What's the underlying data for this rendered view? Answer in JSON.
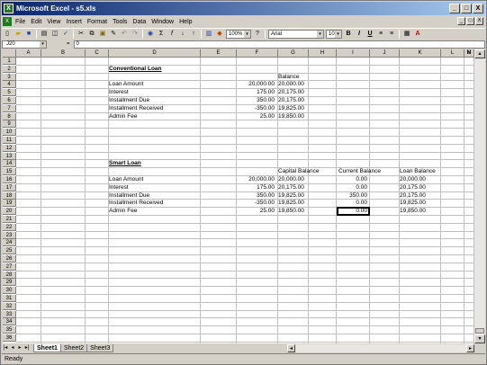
{
  "window": {
    "title": "Microsoft Excel - s5.xls",
    "app_icon": "excel-icon"
  },
  "titlebar_buttons": [
    "_",
    "□",
    "X"
  ],
  "doc_buttons": [
    "_",
    "□",
    "X"
  ],
  "menu": [
    "File",
    "Edit",
    "View",
    "Insert",
    "Format",
    "Tools",
    "Data",
    "Window",
    "Help"
  ],
  "toolbar": {
    "zoom": "100%",
    "font": "Arial",
    "size": "10"
  },
  "formula_bar": {
    "name_box": "J20",
    "fx": "=",
    "value": "0"
  },
  "columns": [
    "A",
    "B",
    "C",
    "D",
    "E",
    "F",
    "G",
    "H",
    "I",
    "J",
    "K",
    "L",
    "M",
    "N"
  ],
  "rows": [
    "1",
    "2",
    "3",
    "4",
    "5",
    "6",
    "7",
    "8",
    "9",
    "10",
    "11",
    "12",
    "13",
    "14",
    "15",
    "16",
    "17",
    "18",
    "19",
    "20",
    "21",
    "22",
    "23",
    "24",
    "25",
    "26",
    "27",
    "28",
    "29",
    "30",
    "31",
    "32",
    "33",
    "34",
    "35",
    "36"
  ],
  "cells": {
    "conv_title": "Conventional Loan",
    "conv_balance_hdr": "Balance",
    "conv_labels": [
      "Loan Amount",
      "Interest",
      "Installment Due",
      "Installment Received",
      "Admin Fee"
    ],
    "conv_values": [
      "20,000.00",
      "175.00",
      "350.00",
      "-350.00",
      "25.00"
    ],
    "conv_balances": [
      "20,000.00",
      "20,175.00",
      "20,175.00",
      "19,825.00",
      "19,850.00"
    ],
    "smart_title": "Smart Loan",
    "smart_hdrs": [
      "Capital Balance",
      "Current Balance",
      "Loan Balance"
    ],
    "smart_labels": [
      "Loan Amount",
      "Interest",
      "Installment Due",
      "Installment Received",
      "Admin Fee"
    ],
    "smart_values": [
      "20,000.00",
      "175.00",
      "350.00",
      "-350.00",
      "25.00"
    ],
    "smart_capital": [
      "20,000.00",
      "20,175.00",
      "19,825.00",
      "19,825.00",
      "19,850.00"
    ],
    "smart_current": [
      "0.00",
      "0.00",
      "350.00",
      "0.00",
      "0.00"
    ],
    "smart_loan": [
      "20,000.00",
      "20,175.00",
      "20,175.00",
      "19,825.00",
      "19,850.00"
    ]
  },
  "sheets": [
    "Sheet1",
    "Sheet2",
    "Sheet3"
  ],
  "active_sheet": "Sheet1",
  "status": "Ready"
}
